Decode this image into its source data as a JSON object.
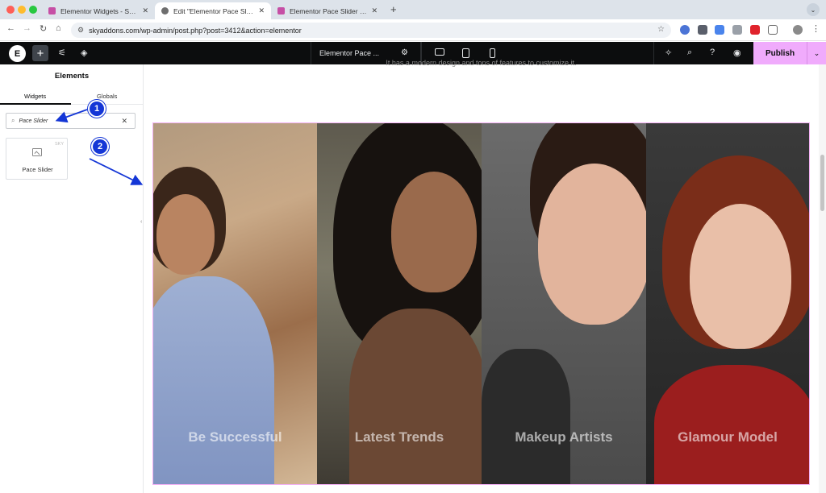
{
  "browser": {
    "tabs": [
      {
        "title": "Elementor Widgets - Sky Addons",
        "active": false,
        "favicon_color": "#c64fa5"
      },
      {
        "title": "Edit \"Elementor Pace Slider Widget\"",
        "active": true,
        "favicon_color": "#6e6e6e"
      },
      {
        "title": "Elementor Pace Slider Widget",
        "active": false,
        "favicon_color": "#c64fa5"
      }
    ],
    "new_tab_label": "+",
    "url": "skyaddons.com/wp-admin/post.php?post=3412&action=elementor"
  },
  "elementor": {
    "document_name": "Elementor Pace ...",
    "publish_label": "Publish",
    "accent": "#f0abfc"
  },
  "panel": {
    "title": "Elements",
    "tabs": [
      "Widgets",
      "Globals"
    ],
    "search_value": "Pace Slider",
    "widget_label": "Pace Slider",
    "widget_badge": "SKY"
  },
  "callouts": [
    "1",
    "2"
  ],
  "canvas": {
    "subtext": "It has a modern design and tons of features to customize it.",
    "slides": [
      {
        "caption": "Be Successful"
      },
      {
        "caption": "Latest Trends"
      },
      {
        "caption": "Makeup Artists"
      },
      {
        "caption": "Glamour Model"
      }
    ]
  },
  "icons": {
    "back": "arrow-left-icon",
    "forward": "arrow-right-icon",
    "reload": "reload-icon",
    "home": "home-icon",
    "star": "bookmark-star-icon",
    "search": "search-icon",
    "help": "help-icon",
    "preview": "eye-icon",
    "settings": "gear-icon",
    "structure": "layers-icon",
    "site_settings": "sliders-icon"
  }
}
